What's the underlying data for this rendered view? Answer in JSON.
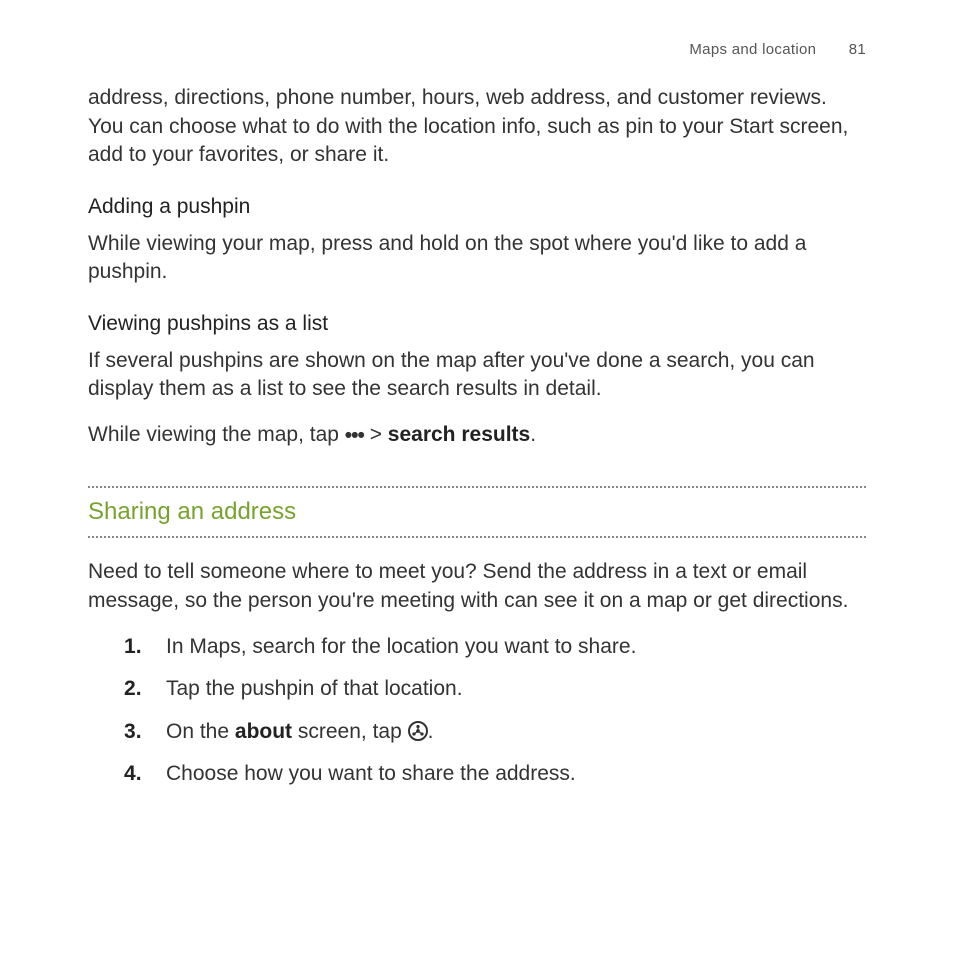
{
  "header": {
    "section": "Maps and location",
    "page": "81"
  },
  "intro": "address, directions, phone number, hours, web address, and customer reviews. You can choose what to do with the location info, such as pin to your Start screen, add to your favorites, or share it.",
  "pushpin": {
    "heading": "Adding a pushpin",
    "text": "While viewing your map, press and hold on the spot where you'd like to add a pushpin."
  },
  "viewing": {
    "heading": "Viewing pushpins as a list",
    "text1": "If several pushpins are shown on the map after you've done a search, you can display them as a list to see the search results in detail.",
    "text2_pre": "While viewing the map, tap ",
    "more_icon": "•••",
    "text2_mid": " > ",
    "text2_bold": "search results",
    "text2_post": "."
  },
  "sharing": {
    "heading": "Sharing an address",
    "intro": "Need to tell someone where to meet you? Send the address in a text or email message, so the person you're meeting with can see it on a map or get directions.",
    "steps": {
      "s1": "In Maps, search for the location you want to share.",
      "s2": "Tap the pushpin of that location.",
      "s3_pre": "On the ",
      "s3_bold": "about",
      "s3_mid": " screen, tap ",
      "s3_post": ".",
      "s4": "Choose how you want to share the address."
    }
  }
}
